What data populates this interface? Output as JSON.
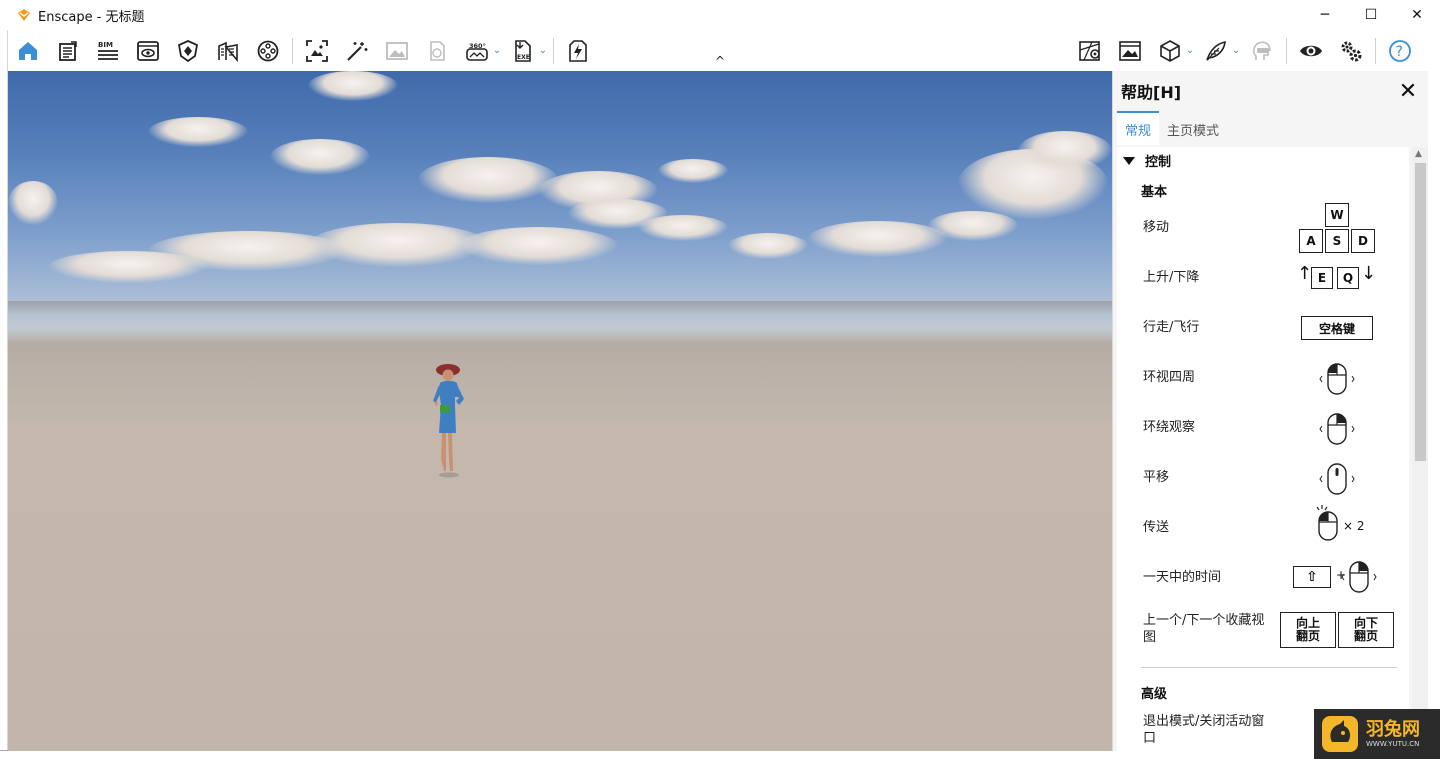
{
  "window": {
    "title": "Enscape - 无标题",
    "controls": {
      "minimize": "─",
      "maximize": "☐",
      "close": "✕"
    }
  },
  "toolbar": {
    "left_icons": [
      "home-icon",
      "document-icon",
      "bim-icon",
      "eye-window-icon",
      "light-shield-icon",
      "building-icon",
      "film-reel-icon"
    ],
    "bim_label": "BIM",
    "capture_icons": [
      "screenshot-icon",
      "magic-wand-icon",
      "image-batch-icon",
      "panorama-icon",
      "pano-360-icon",
      "exe-export-icon",
      "lightning-icon"
    ],
    "pano_label": "360°",
    "exe_label": "EXE",
    "right_icons": [
      "map-pin-icon",
      "image-library-icon",
      "cube-asset-icon",
      "feather-icon",
      "vr-headset-icon",
      "visual-settings-icon",
      "settings-gears-icon",
      "help-icon"
    ],
    "help_label": "?",
    "collapse_caret": "^"
  },
  "panel": {
    "title": "帮助[H]",
    "close": "✕",
    "tabs": [
      {
        "label": "常规",
        "active": true
      },
      {
        "label": "主页模式",
        "active": false
      }
    ],
    "section": "控制",
    "basic_heading": "基本",
    "rows": [
      {
        "label": "移动",
        "keys": [
          "W",
          "A",
          "S",
          "D"
        ]
      },
      {
        "label": "上升/下降",
        "keys": [
          "E",
          "Q"
        ],
        "up_arrow": "↑",
        "down_arrow": "↓"
      },
      {
        "label": "行走/飞行",
        "key": "空格键"
      },
      {
        "label": "环视四周"
      },
      {
        "label": "环绕观察"
      },
      {
        "label": "平移"
      },
      {
        "label": "传送",
        "suffix": "× 2"
      },
      {
        "label": "一天中的时间",
        "shift": "⇧",
        "plus": "+"
      },
      {
        "label": "上一个/下一个收藏视图",
        "key_up": "向上\n翻页",
        "key_down": "向下\n翻页"
      }
    ],
    "advanced_heading": "高级",
    "advanced_rows": [
      {
        "label": "退出模式/关闭活动窗口"
      }
    ]
  },
  "watermark": {
    "name": "羽兔网",
    "url": "WWW.YUTU.CN"
  },
  "colors": {
    "accent": "#3a8fd6",
    "logo_orange": "#f29b1d"
  }
}
